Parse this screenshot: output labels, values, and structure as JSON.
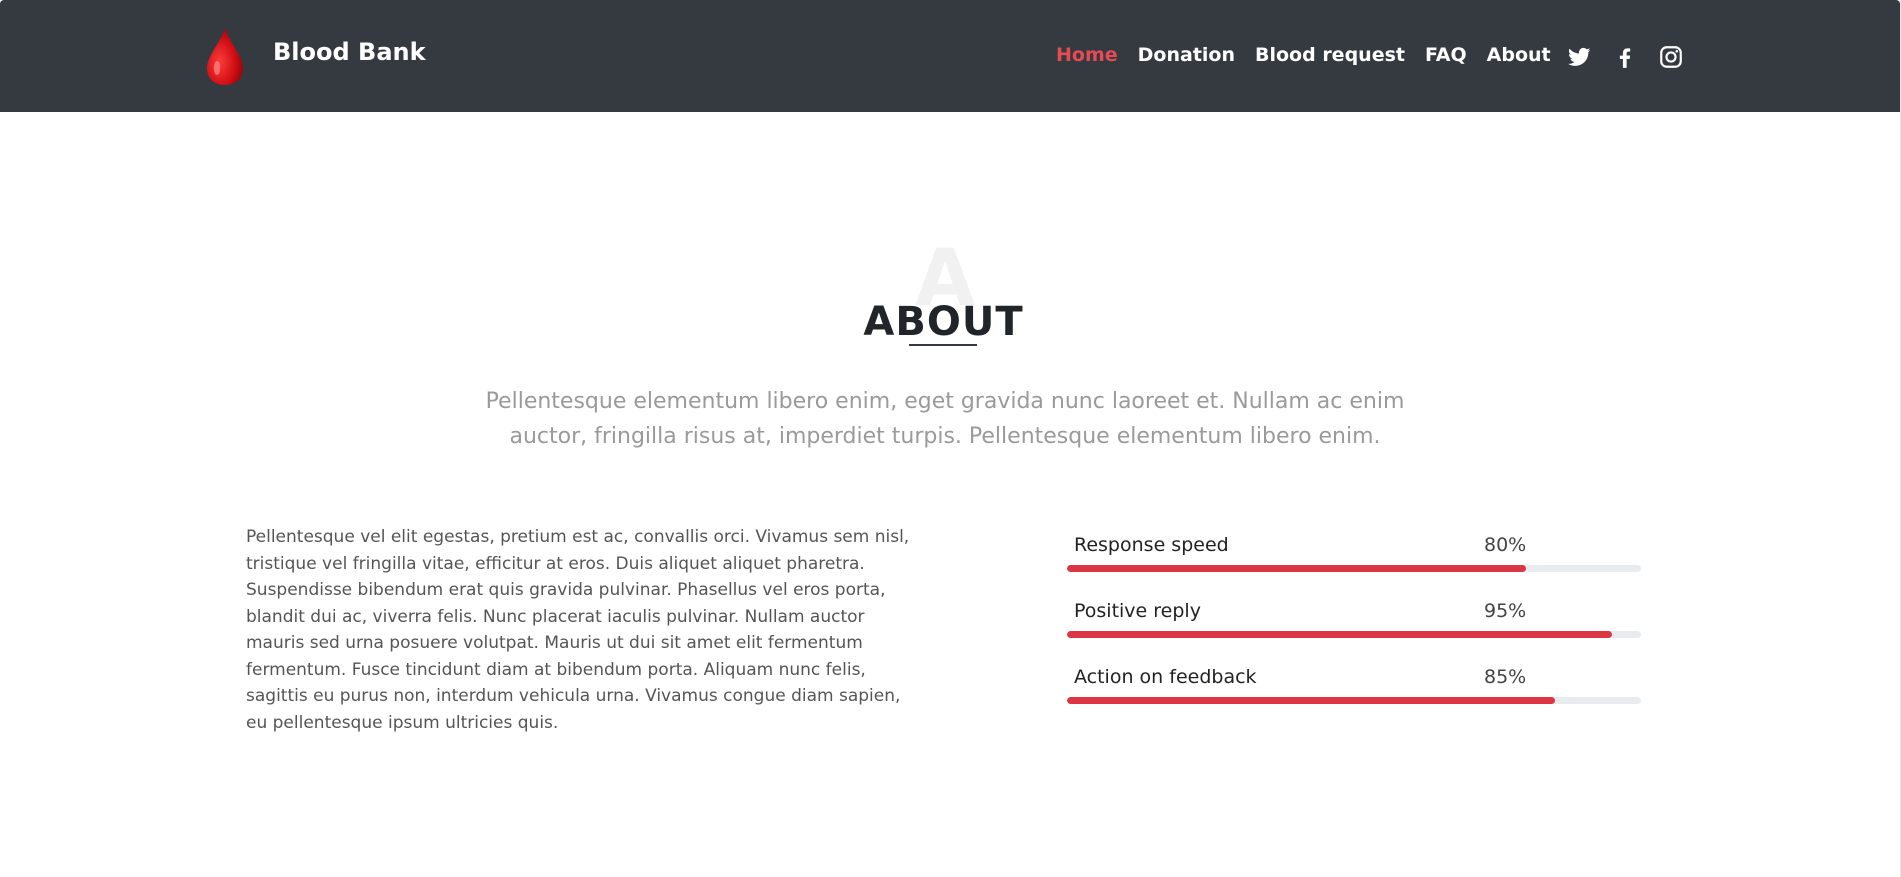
{
  "header": {
    "brand": "Blood Bank",
    "logo_icon": "blood-drop-icon",
    "nav": [
      {
        "label": "Home",
        "active": true
      },
      {
        "label": "Donation",
        "active": false
      },
      {
        "label": "Blood request",
        "active": false
      },
      {
        "label": "FAQ",
        "active": false
      },
      {
        "label": "About",
        "active": false
      }
    ],
    "social": [
      "twitter-icon",
      "facebook-icon",
      "instagram-icon"
    ]
  },
  "about": {
    "watermark": "A",
    "title": "ABOUT",
    "intro": "Pellentesque elementum libero enim, eget gravida nunc laoreet et. Nullam ac enim auctor, fringilla risus at, imperdiet turpis. Pellentesque elementum libero enim.",
    "body": "Pellentesque vel elit egestas, pretium est ac, convallis orci. Vivamus sem nisl, tristique vel fringilla vitae, efficitur at eros. Duis aliquet aliquet pharetra. Suspendisse bibendum erat quis gravida pulvinar. Phasellus vel eros porta, blandit dui ac, viverra felis. Nunc placerat iaculis pulvinar. Nullam auctor mauris sed urna posuere volutpat. Mauris ut dui sit amet elit fermentum fermentum. Fusce tincidunt diam at bibendum porta. Aliquam nunc felis, sagittis eu purus non, interdum vehicula urna. Vivamus congue diam sapien, eu pellentesque ipsum ultricies quis.",
    "skills": [
      {
        "name": "Response speed",
        "value_label": "80%",
        "percent": 80
      },
      {
        "name": "Positive reply",
        "value_label": "95%",
        "percent": 95
      },
      {
        "name": "Action on feedback",
        "value_label": "85%",
        "percent": 85
      }
    ]
  },
  "colors": {
    "navbar": "#343a40",
    "active_nav": "#e84a55",
    "progress": "#dc3545",
    "track": "#e9ecef"
  }
}
